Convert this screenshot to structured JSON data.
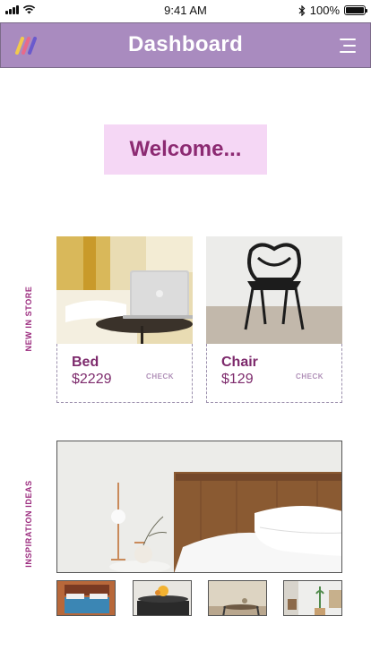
{
  "status_bar": {
    "time": "9:41 AM",
    "battery": "100%"
  },
  "header": {
    "title": "Dashboard"
  },
  "welcome": {
    "text": "Welcome..."
  },
  "sections": {
    "new_in_store": "NEW IN STORE",
    "inspiration": "INSPIRATION IDEAS"
  },
  "products": [
    {
      "name": "Bed",
      "price": "$2229",
      "action": "CHECK"
    },
    {
      "name": "Chair",
      "price": "$129",
      "action": "CHECK"
    }
  ],
  "colors": {
    "header_bg": "#a98bbf",
    "accent": "#8c2a72",
    "welcome_bg": "#f5d7f5"
  },
  "icons": {
    "logo": "app-logo-stripes-icon",
    "menu": "hamburger-menu-icon"
  }
}
